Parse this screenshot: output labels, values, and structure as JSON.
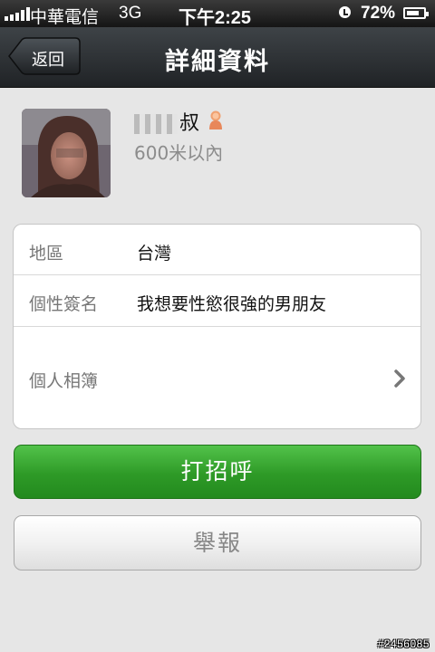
{
  "status_bar": {
    "carrier": "中華電信",
    "network": "3G",
    "time": "下午2:25",
    "battery_percent": "72%",
    "signal_bars": 5,
    "battery_level": 0.72,
    "icons": [
      "signal-icon",
      "alarm-icon",
      "battery-icon"
    ]
  },
  "nav": {
    "back_label": "返回",
    "title": "詳細資料"
  },
  "profile": {
    "name_suffix": "叔",
    "distance": "600米以內",
    "gender_icon": "female-icon"
  },
  "details": [
    {
      "label": "地區",
      "value": "台灣"
    },
    {
      "label": "個性簽名",
      "value": "我想要性慾很強的男朋友"
    },
    {
      "label": "個人相簿",
      "value": ""
    }
  ],
  "buttons": {
    "greet": "打招呼",
    "report": "舉報"
  },
  "watermark": "#2456085",
  "colors": {
    "greet_button": "#2e9a27",
    "navbar": "#2a2e31",
    "background": "#e6e6e6"
  }
}
